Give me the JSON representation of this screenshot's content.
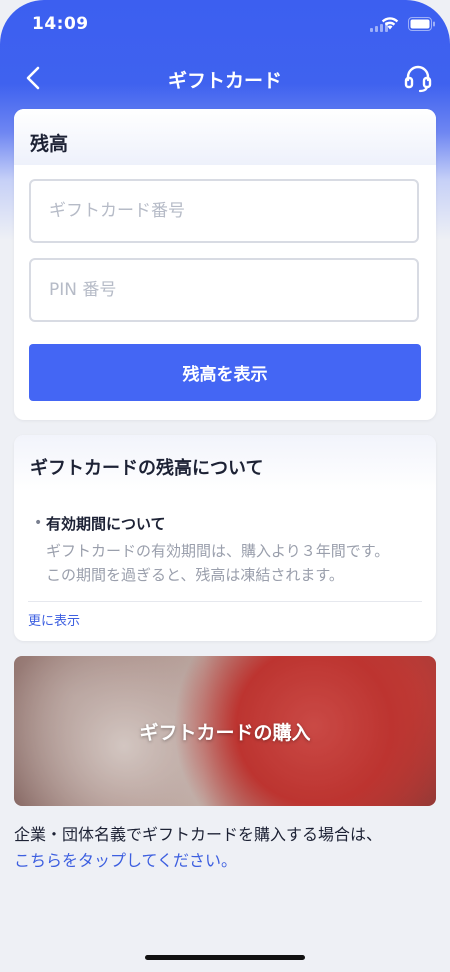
{
  "status": {
    "time": "14:09"
  },
  "nav": {
    "title": "ギフトカード",
    "back_icon": "chevron-left-icon",
    "support_icon": "headset-icon"
  },
  "balance": {
    "title": "残高",
    "card_number_placeholder": "ギフトカード番号",
    "pin_placeholder": "PIN 番号",
    "button": "残高を表示"
  },
  "about": {
    "title": "ギフトカードの残高について",
    "bullet": "•",
    "subhead": "有効期間について",
    "desc_line1": "ギフトカードの有効期間は、購入より３年間です。",
    "desc_line2": "この期間を過ぎると、残高は凍結されます。",
    "more": "更に表示"
  },
  "purchase": {
    "banner_title": "ギフトカードの購入"
  },
  "corporate": {
    "text": "企業・団体名義でギフトカードを購入する場合は、",
    "link": "こちらをタップしてください。"
  },
  "colors": {
    "accent": "#4466f4",
    "link": "#3d5fe0"
  }
}
